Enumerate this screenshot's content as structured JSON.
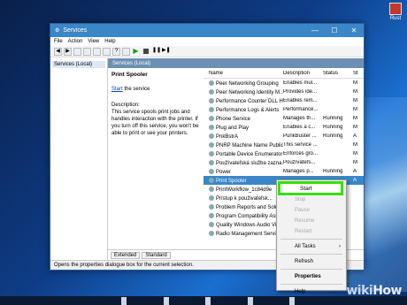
{
  "desktop": {
    "icon_label": "Rust"
  },
  "window": {
    "title": "Services",
    "controls": [
      "—",
      "☐",
      "✕"
    ],
    "menu": [
      "File",
      "Action",
      "View",
      "Help"
    ],
    "tree_item": "Services (Local)",
    "header": "Services (Local)",
    "desc_pane": {
      "service_name": "Print Spooler",
      "start_link": "Start",
      "start_suffix": " the service",
      "desc_label": "Description:",
      "desc_text": "This service spools print jobs and handles interaction with the printer. If you turn off this service, you won't be able to print or see your printers."
    },
    "columns": [
      "Name",
      "Description",
      "Status",
      "St"
    ],
    "rows": [
      {
        "name": "Peer Networking Grouping",
        "desc": "Enables mul...",
        "status": "",
        "st": "M"
      },
      {
        "name": "Peer Networking Identity M...",
        "desc": "Provides ide...",
        "status": "",
        "st": "M"
      },
      {
        "name": "Performance Counter DLL H...",
        "desc": "Enables rem...",
        "status": "",
        "st": "M"
      },
      {
        "name": "Performance Logs & Alerts",
        "desc": "Performance...",
        "status": "",
        "st": "M"
      },
      {
        "name": "Phone Service",
        "desc": "Manages th...",
        "status": "Running",
        "st": "M"
      },
      {
        "name": "Plug and Play",
        "desc": "Enables a c...",
        "status": "Running",
        "st": "M"
      },
      {
        "name": "PnkBstrA",
        "desc": "PunkBuster ...",
        "status": "Running",
        "st": "A"
      },
      {
        "name": "PNRP Machine Name Public...",
        "desc": "This service ...",
        "status": "",
        "st": "M"
      },
      {
        "name": "Portable Device Enumerator ...",
        "desc": "Enforces gro...",
        "status": "",
        "st": "M"
      },
      {
        "name": "Používateľská služba zazna...",
        "desc": "Používateľs...",
        "status": "",
        "st": "M"
      },
      {
        "name": "Power",
        "desc": "Manages p...",
        "status": "Running",
        "st": "A"
      },
      {
        "name": "Print Spooler",
        "desc": "",
        "status": "",
        "st": "A"
      },
      {
        "name": "PrintWorkflow_1c84d9e",
        "desc": "",
        "status": "",
        "st": ""
      },
      {
        "name": "Prístup k použivateľsk...",
        "desc": "",
        "status": "",
        "st": ""
      },
      {
        "name": "Problem Reports and Solution...",
        "desc": "",
        "status": "",
        "st": ""
      },
      {
        "name": "Program Compatibility Assis...",
        "desc": "",
        "status": "",
        "st": ""
      },
      {
        "name": "Quality Windows Audio Vid...",
        "desc": "",
        "status": "",
        "st": ""
      },
      {
        "name": "Radio Management Service",
        "desc": "",
        "status": "",
        "st": ""
      }
    ],
    "tabs": [
      "Extended",
      "Standard"
    ],
    "status_text": "Opens the properties dialogue box for the current selection."
  },
  "context_menu": {
    "start": "Start",
    "stop": "Stop",
    "pause": "Pause",
    "resume": "Resume",
    "restart": "Restart",
    "all_tasks": "All Tasks",
    "refresh": "Refresh",
    "properties": "Properties",
    "help": "Help"
  },
  "watermark": {
    "prefix": "wiki",
    "suffix": "How"
  },
  "colors": {
    "highlight": "#35e100",
    "titlebar": "#3a87c8",
    "selection": "#3a87c8"
  }
}
